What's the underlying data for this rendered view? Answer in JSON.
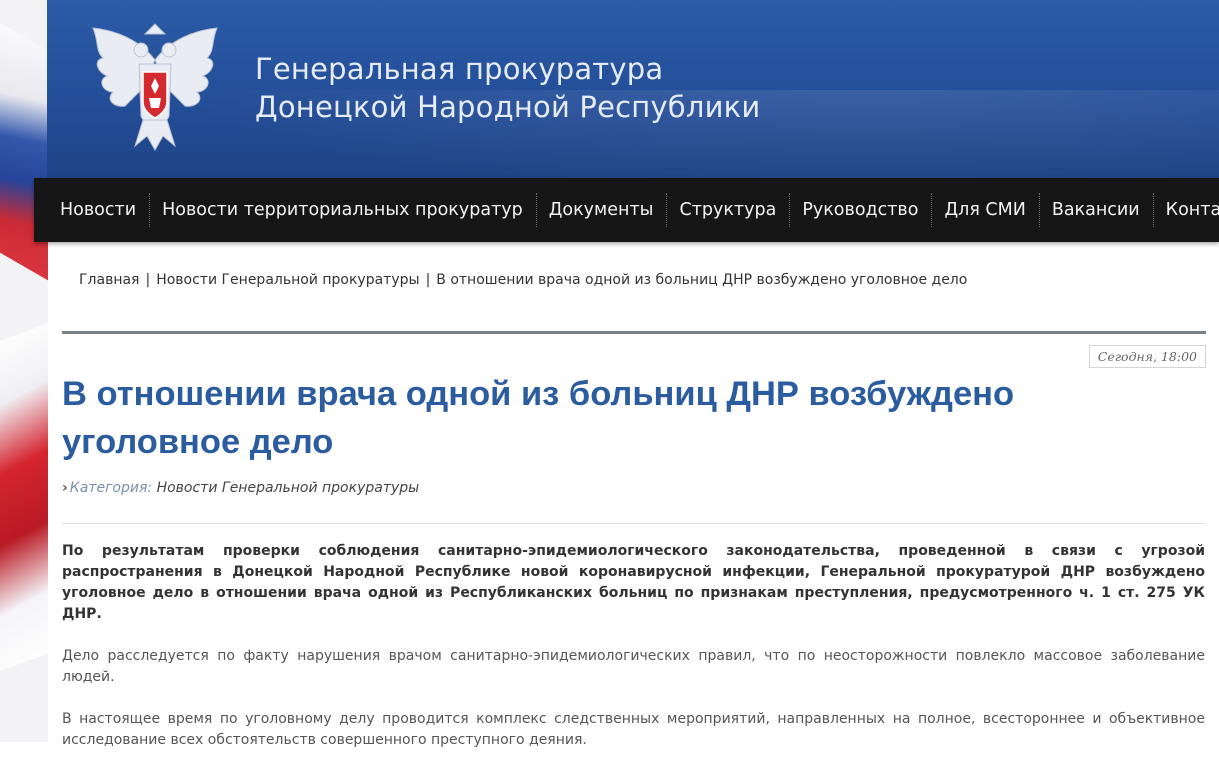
{
  "header": {
    "title_line1": "Генеральная прокуратура",
    "title_line2": "Донецкой Народной Республики",
    "emblem": "coat-of-arms-eagle"
  },
  "nav": {
    "items": [
      {
        "label": "Новости"
      },
      {
        "label": "Новости территориальных прокуратур"
      },
      {
        "label": "Документы"
      },
      {
        "label": "Структура"
      },
      {
        "label": "Руководство"
      },
      {
        "label": "Для СМИ"
      },
      {
        "label": "Вакансии"
      },
      {
        "label": "Контакты"
      }
    ]
  },
  "breadcrumb": {
    "home": "Главная",
    "section": "Новости Генеральной прокуратуры",
    "current": "В отношении врача одной из больниц ДНР возбуждено уголовное дело",
    "separator": "|"
  },
  "article": {
    "date": "Сегодня, 18:00",
    "title": "В отношении врача одной из больниц ДНР возбуждено уголовное дело",
    "category_label": "Категория:",
    "category_value": "Новости Генеральной прокуратуры",
    "paragraphs": [
      "По результатам проверки соблюдения санитарно-эпидемиологического законодательства, проведенной в связи с угрозой распространения в Донецкой Народной Республике новой коронавирусной инфекции, Генеральной прокуратурой ДНР возбуждено уголовное дело в отношении врача одной из Республиканских больниц по признакам преступления, предусмотренного ч. 1 ст. 275 УК ДНР.",
      "Дело расследуется по факту нарушения врачом санитарно-эпидемиологических правил, что по неосторожности повлекло массовое заболевание людей.",
      "В настоящее время по уголовному делу проводится комплекс следственных мероприятий, направленных на полное, всестороннее и объективное исследование всех обстоятельств совершенного преступного деяния."
    ]
  },
  "colors": {
    "header_bg": "#2c5ba7",
    "nav_bg": "#161616",
    "title_color": "#2b5c9f"
  }
}
